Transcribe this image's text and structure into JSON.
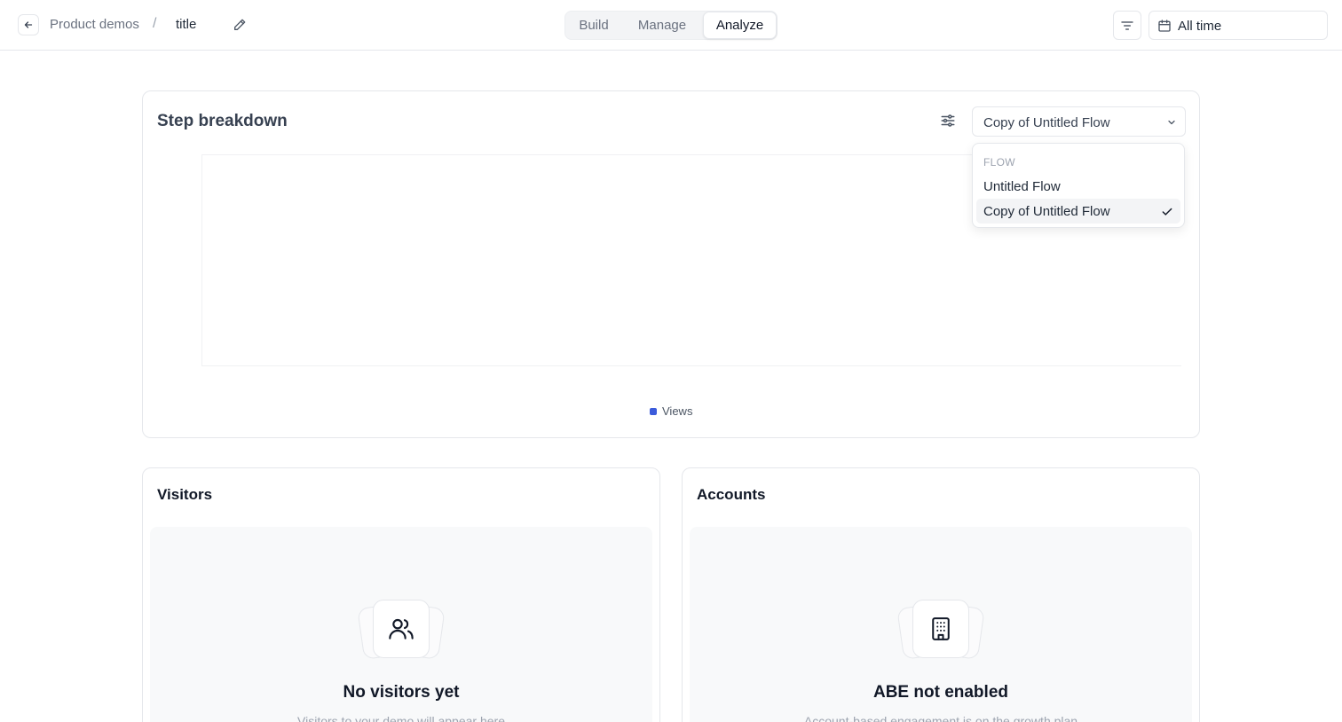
{
  "header": {
    "breadcrumb_parent": "Product demos",
    "breadcrumb_separator": "/",
    "breadcrumb_current": "title",
    "tabs": [
      {
        "label": "Build"
      },
      {
        "label": "Manage"
      },
      {
        "label": "Analyze",
        "active": true
      }
    ],
    "date_range": "All time"
  },
  "step_breakdown": {
    "title": "Step breakdown",
    "selected_flow": "Copy of Untitled Flow",
    "legend_label": "Views",
    "legend_color": "#3b5bdb",
    "dropdown": {
      "heading": "FLOW",
      "options": [
        {
          "label": "Untitled Flow",
          "selected": false
        },
        {
          "label": "Copy of Untitled Flow",
          "selected": true
        }
      ]
    }
  },
  "visitors": {
    "title": "Visitors",
    "empty_title": "No visitors yet",
    "empty_subtitle": "Visitors to your demo will appear here",
    "icon": "users-icon"
  },
  "accounts": {
    "title": "Accounts",
    "empty_title": "ABE not enabled",
    "empty_subtitle": "Account-based engagement is on the growth plan",
    "icon": "building-icon"
  }
}
